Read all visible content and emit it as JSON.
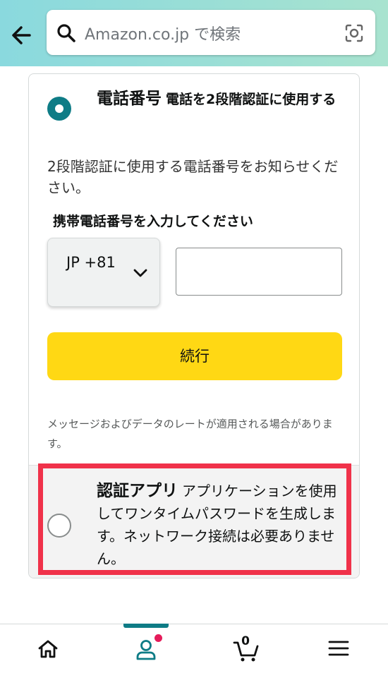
{
  "header": {
    "search_placeholder": "Amazon.co.jp で検索",
    "icons": {
      "back": "back-arrow-icon",
      "search": "search-icon",
      "camera": "camera-icon"
    }
  },
  "option_phone": {
    "title": "電話番号",
    "description": "電話を2段階認証に使用する",
    "selected": true,
    "info": "2段階認証に使用する電話番号をお知らせください。",
    "input_label": "携帯電話番号を入力してください",
    "country_code": "JP +81",
    "phone_value": "",
    "continue_label": "続行",
    "note": "メッセージおよびデータのレートが適用される場合があります。"
  },
  "option_app": {
    "title": "認証アプリ",
    "description": "アプリケーションを使用してワンタイムパスワードを生成します。ネットワーク接続は必要ありません。",
    "selected": false
  },
  "bottom_nav": {
    "items": [
      "home-icon",
      "account-icon",
      "cart-icon",
      "menu-icon"
    ],
    "active": "account",
    "cart_count": "0"
  },
  "colors": {
    "accent": "#0e7c86",
    "button": "#ffd814",
    "highlight": "#f0324a"
  }
}
